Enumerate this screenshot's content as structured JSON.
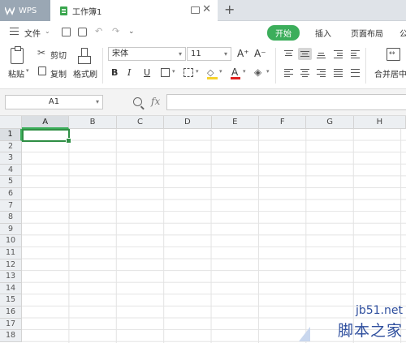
{
  "titlebar": {
    "app_tab": "WPS",
    "doc_tab": "工作簿1",
    "close": "✕",
    "new_tab": "+"
  },
  "menu": {
    "file": "文件",
    "file_caret": "⌄",
    "tabs": [
      "开始",
      "插入",
      "页面布局",
      "公"
    ],
    "active_tab": "开始"
  },
  "ribbon": {
    "paste": "粘贴",
    "paste_caret": "▾",
    "cut": "剪切",
    "copy": "复制",
    "format_painter": "格式刷",
    "font_name": "宋体",
    "font_size": "11",
    "grow": "A⁺",
    "shrink": "A⁻",
    "bold": "B",
    "italic": "I",
    "underline": "U",
    "font_color_letter": "A",
    "merge_center": "合并居中",
    "accent_color": "#3cae5b",
    "font_color": "#e02020",
    "fill_color": "#f6d22b"
  },
  "formula_bar": {
    "name_box": "A1",
    "fx": "fx",
    "value": ""
  },
  "sheet": {
    "columns": [
      "A",
      "B",
      "C",
      "D",
      "E",
      "F",
      "G",
      "H"
    ],
    "rows": [
      "1",
      "2",
      "3",
      "4",
      "5",
      "6",
      "7",
      "8",
      "9",
      "10",
      "11",
      "12",
      "13",
      "14",
      "15",
      "16",
      "17",
      "18"
    ],
    "selected_cell": "A1"
  },
  "watermark": {
    "url": "jb51.net",
    "name": "脚本之家"
  }
}
